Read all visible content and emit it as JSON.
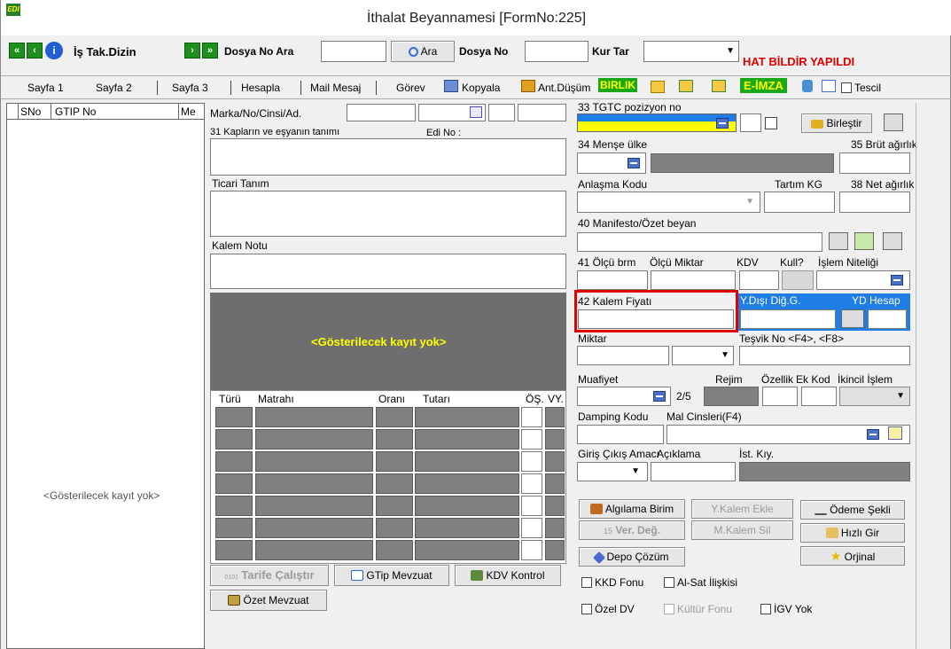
{
  "window": {
    "title": "İthalat Beyannamesi [FormNo:225]",
    "app_icon": "EDI"
  },
  "toolbar": {
    "is_tak_label": "İş Tak.Dizin",
    "dosya_no_ara_label": "Dosya No Ara",
    "ara_button": "Ara",
    "dosya_no_label": "Dosya No",
    "kur_tar_label": "Kur Tar",
    "status": "HAT BİLDİR YAPILDI"
  },
  "tabs": [
    "Sayfa 1",
    "Sayfa 2",
    "Sayfa 3",
    "Hesapla",
    "Mail Mesaj",
    "Görev",
    "Kopyala",
    "Ant.Düşüm",
    "BIRLIK",
    "E-İMZA",
    "Tescil"
  ],
  "left_grid": {
    "columns": [
      "SNo",
      "GTIP No",
      "Me"
    ],
    "empty_text": "<Gösterilecek kayıt yok>"
  },
  "form": {
    "marka": "Marka/No/Cinsi/Ad.",
    "kaplarin": "31 Kapların ve eşyanın tanımı",
    "edi_no": "Edi No :",
    "ticari": "Ticari Tanım",
    "kalem_notu": "Kalem Notu",
    "empty_text": "<Gösterilecek kayıt yok>",
    "tax_cols": [
      "Türü",
      "Matrahı",
      "Oranı",
      "Tutarı",
      "ÖŞ.",
      "VY."
    ],
    "tgtc": "33 TGTC pozizyon no",
    "birlestir": "Birleştir",
    "mense": "34 Menşe ülke",
    "brut": "35 Brüt ağırlık",
    "anlasma": "Anlaşma Kodu",
    "tartim": "Tartım KG",
    "net": "38 Net ağırlık",
    "manifesto": "40 Manifesto/Özet beyan",
    "olcu_brm": "41 Ölçü brm",
    "olcu_miktar": "Ölçü Miktar",
    "kdv": "KDV",
    "kull": "Kull?",
    "islem": "İşlem Niteliği",
    "kalem_fiyati": "42 Kalem Fiyatı",
    "ydisi": "Y.Dışı Diğ.G.",
    "yd_hesap": "YD Hesap",
    "miktar": "Miktar",
    "tesvik": "Teşvik No <F4>, <F8>",
    "muafiyet": "Muafiyet",
    "rejim": "Rejim",
    "rejim_val": "2/5",
    "ozellik": "Özellik",
    "ek_kod": "Ek Kod",
    "ikincil": "İkincil İşlem",
    "damping": "Damping Kodu",
    "mal_cinsleri": "Mal Cinsleri(F4)",
    "giris_cikis": "Giriş Çıkış Amacı",
    "aciklama": "Açıklama",
    "ist_kiy": "İst. Kıy."
  },
  "buttons": {
    "algilama": "Algılama Birim",
    "y_kalem_ekle": "Y.Kalem Ekle",
    "odeme_sekli": "Ödeme Şekli",
    "ver_deg_num": "15",
    "ver_deg": "Ver. Değ.",
    "m_kalem_sil": "M.Kalem Sil",
    "hizli_gir": "Hızlı Gir",
    "depo": "Depo Çözüm",
    "orjinal": "Orjinal",
    "tarife_num": "0101",
    "tarife": "Tarife Çalıştır",
    "gtip_mevzuat": "GTip Mevzuat",
    "kdv_kontrol": "KDV Kontrol",
    "ozet_mevzuat": "Özet Mevzuat"
  },
  "checks": [
    "KKD Fonu",
    "Al-Sat İlişkisi",
    "Özel DV",
    "Kültür Fonu",
    "İGV Yok"
  ],
  "colors": {
    "highlight_red": "#e00000",
    "accent_blue": "#1e7ee6",
    "birlik_green": "#18a818",
    "yellow": "#ffff00"
  }
}
